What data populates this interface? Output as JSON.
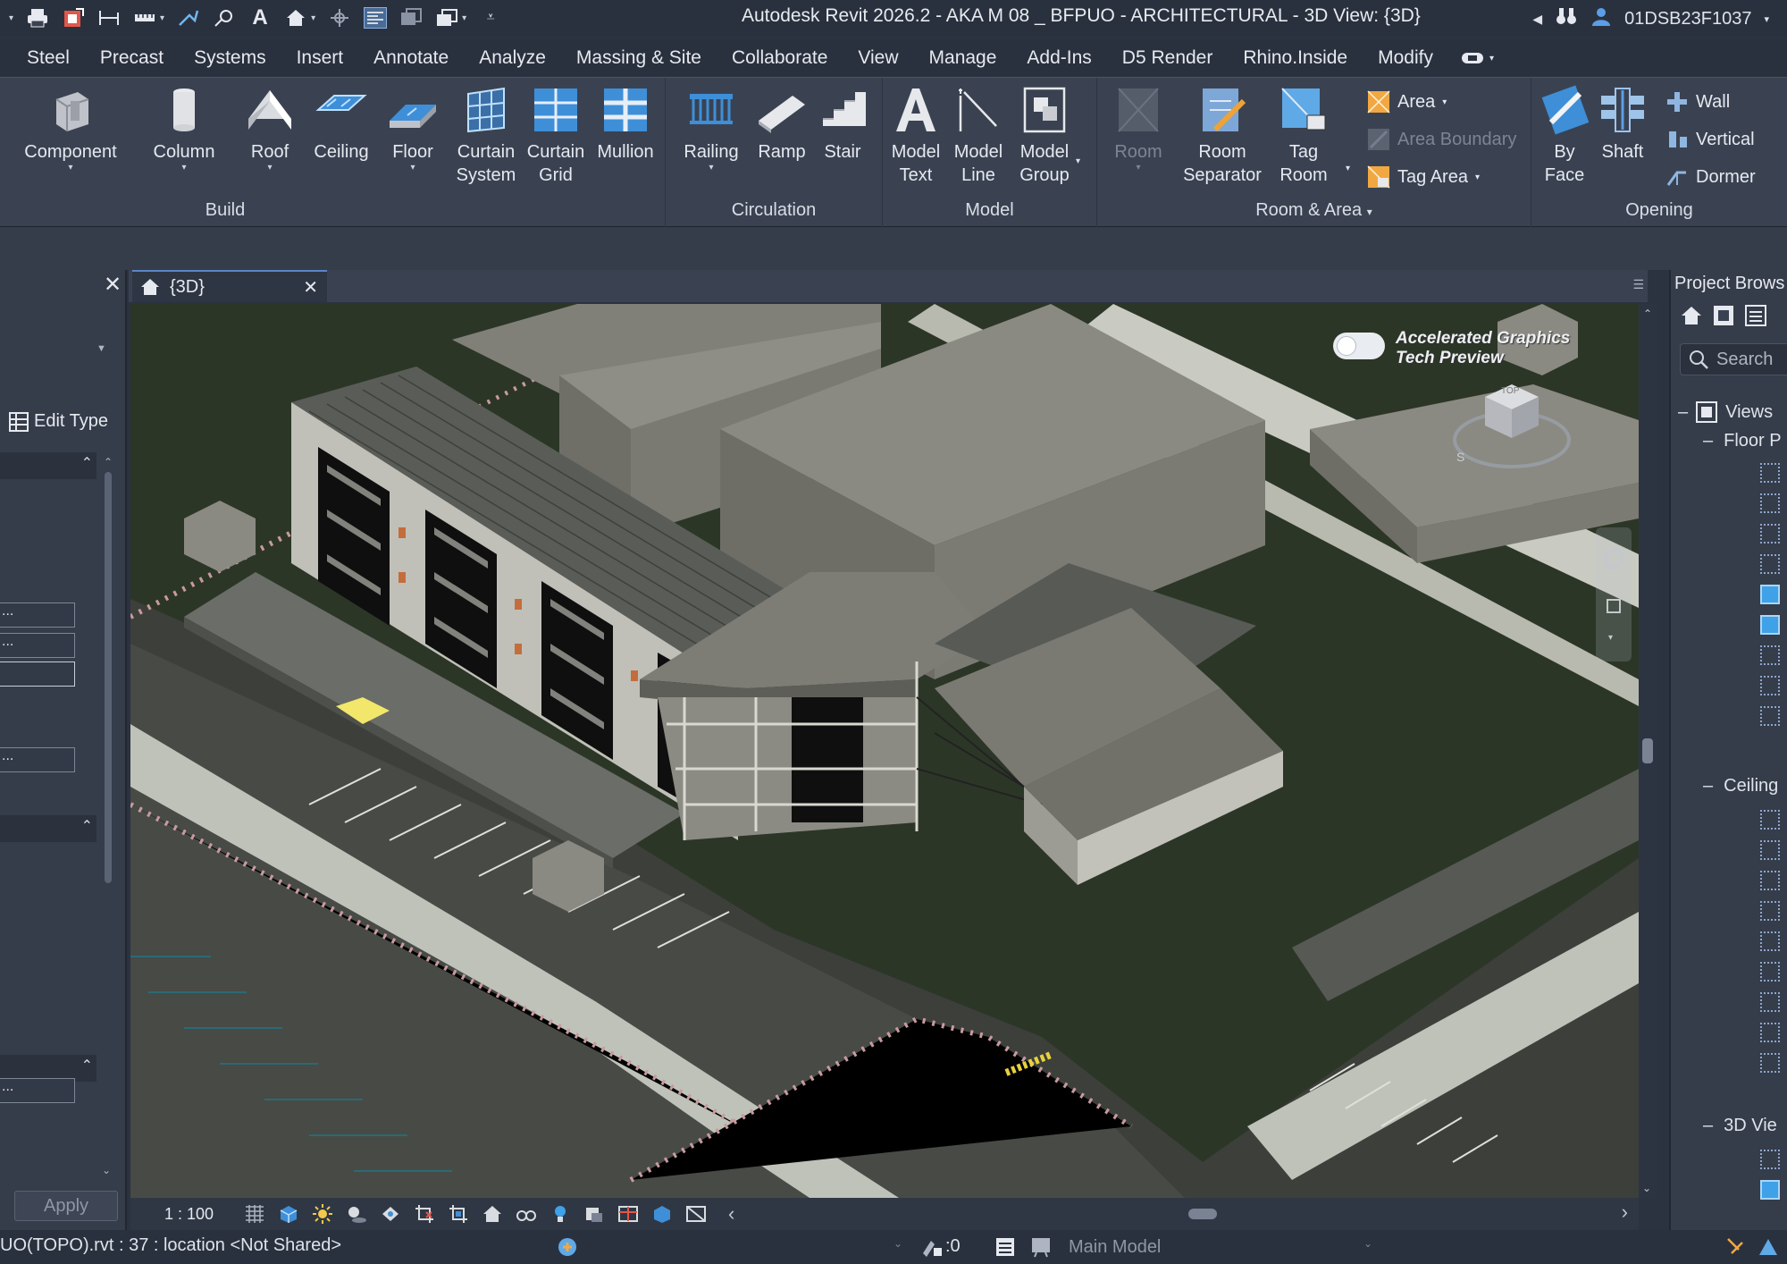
{
  "title": {
    "text": "Autodesk Revit 2026.2 - AKA M 08 _ BFPUO - ARCHITECTURAL - 3D View: {3D}",
    "user": "01DSB23F1037"
  },
  "menu": [
    "Steel",
    "Precast",
    "Systems",
    "Insert",
    "Annotate",
    "Analyze",
    "Massing & Site",
    "Collaborate",
    "View",
    "Manage",
    "Add-Ins",
    "D5 Render",
    "Rhino.Inside",
    "Modify"
  ],
  "ribbon": {
    "build": {
      "title": "Build",
      "component": "Component",
      "column": "Column",
      "roof": "Roof",
      "ceiling": "Ceiling",
      "floor": "Floor",
      "curtain_system_1": "Curtain",
      "curtain_system_2": "System",
      "curtain_grid_1": "Curtain",
      "curtain_grid_2": "Grid",
      "mullion": "Mullion"
    },
    "circulation": {
      "title": "Circulation",
      "railing": "Railing",
      "ramp": "Ramp",
      "stair": "Stair"
    },
    "model": {
      "title": "Model",
      "model_text_1": "Model",
      "model_text_2": "Text",
      "model_line_1": "Model",
      "model_line_2": "Line",
      "model_group_1": "Model",
      "model_group_2": "Group"
    },
    "room_area": {
      "title": "Room & Area",
      "room": "Room",
      "room_separator_1": "Room",
      "room_separator_2": "Separator",
      "tag_room_1": "Tag",
      "tag_room_2": "Room",
      "area": "Area",
      "area_boundary": "Area  Boundary",
      "tag_area": "Tag  Area"
    },
    "opening": {
      "title": "Opening",
      "by_face_1": "By",
      "by_face_2": "Face",
      "shaft": "Shaft",
      "wall": "Wall",
      "vertical": "Vertical",
      "dormer": "Dormer"
    }
  },
  "properties": {
    "edit_type": "Edit Type",
    "apply": "Apply"
  },
  "view": {
    "tab_label": "{3D}",
    "scale": "1 : 100",
    "toggle_label_1": "Accelerated Graphics",
    "toggle_label_2": "Tech Preview",
    "viewcube_label": "TOP"
  },
  "browser": {
    "title": "Project Brows",
    "search_placeholder": "Search",
    "views": "Views",
    "floor_plans": "Floor P",
    "ceiling": "Ceiling",
    "views_3d": "3D Vie"
  },
  "status": {
    "left_text": "UO(TOPO).rvt : 37 : location <Not Shared>",
    "worksets": ":0",
    "model": "Main Model"
  },
  "colors": {
    "accent": "#3fa1e8",
    "ribbon_bg": "#3a4252",
    "viewport_grass": "#2f3a2a"
  }
}
